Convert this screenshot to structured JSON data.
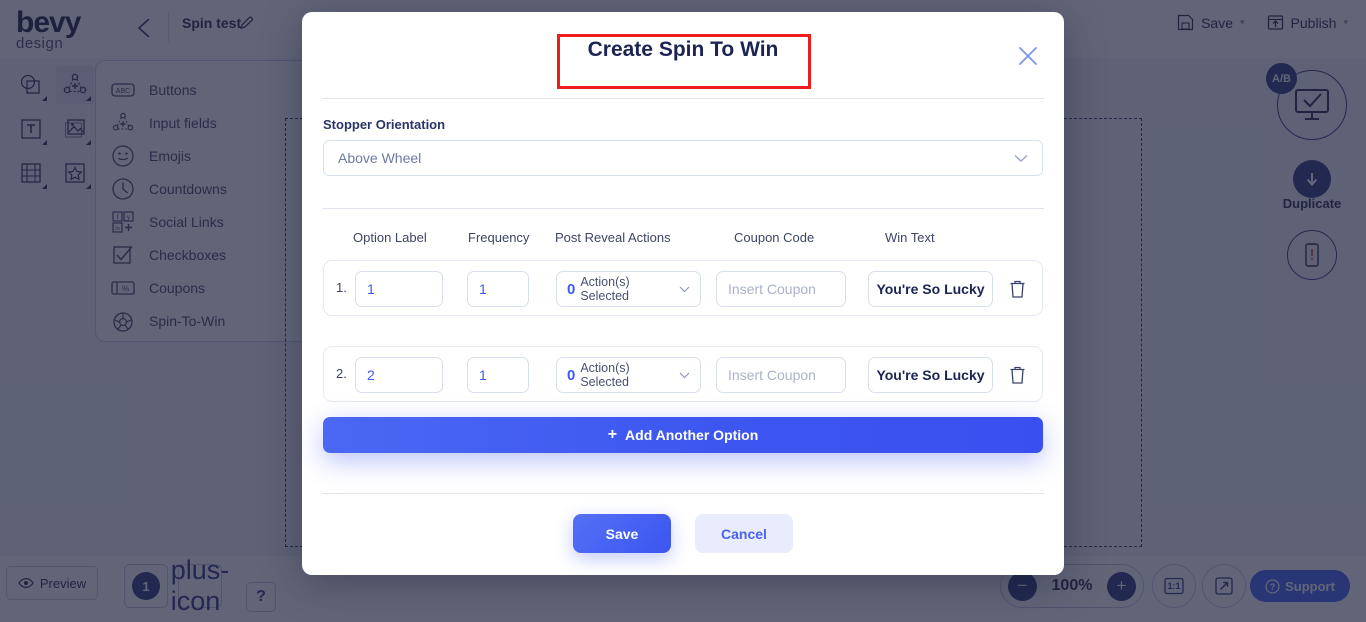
{
  "app": {
    "logo_main": "bevy",
    "logo_sub": "design",
    "project_name": "Spin test",
    "back_icon": "chevron-left-icon",
    "edit_icon": "pencil-icon"
  },
  "topbar": {
    "actions": [
      {
        "label": "Save",
        "icon": "floppy-disk-icon",
        "caret": "▾"
      },
      {
        "label": "Publish",
        "icon": "publish-upload-icon",
        "caret": "▾"
      }
    ]
  },
  "tool_palette": {
    "items": [
      {
        "name": "shapes-tool",
        "icon": "shapes-icon",
        "active": false
      },
      {
        "name": "elements-tool",
        "icon": "elements-node-icon",
        "active": true
      },
      {
        "name": "text-tool",
        "icon": "text-t-icon",
        "active": false
      },
      {
        "name": "image-tool",
        "icon": "image-icon",
        "active": false
      },
      {
        "name": "video-tool",
        "icon": "film-strip-icon",
        "active": false
      },
      {
        "name": "shape-star-tool",
        "icon": "star-icon",
        "active": false
      }
    ]
  },
  "flyout_menu": {
    "items": [
      {
        "label": "Buttons",
        "icon": "abc-button-icon"
      },
      {
        "label": "Input fields",
        "icon": "input-node-icon"
      },
      {
        "label": "Emojis",
        "icon": "smiley-icon"
      },
      {
        "label": "Countdowns",
        "icon": "clock-icon"
      },
      {
        "label": "Social Links",
        "icon": "social-grid-icon"
      },
      {
        "label": "Checkboxes",
        "icon": "checkbox-icon"
      },
      {
        "label": "Coupons",
        "icon": "coupon-percent-icon"
      },
      {
        "label": "Spin-To-Win",
        "icon": "spin-wheel-icon"
      }
    ]
  },
  "right_rail": {
    "ab_badge": "A/B",
    "ab_icon": "monitor-check-icon",
    "duplicate_label": "Duplicate",
    "duplicate_icon": "arrow-down-circle-icon",
    "mobile_icon": "mobile-alert-icon"
  },
  "bottombar": {
    "preview_label": "Preview",
    "preview_icon": "eye-icon",
    "page_number": "1",
    "add_page_icon": "plus-icon",
    "help_label": "?",
    "zoom": {
      "minus": "−",
      "value": "100%",
      "plus": "+"
    },
    "fit_label": "1:1",
    "expand_icon": "expand-arrow-icon",
    "support_label": "Support",
    "support_icon": "question-circle-icon"
  },
  "modal": {
    "title": "Create Spin To Win",
    "close_icon": "close-x-icon",
    "annotation_color": "#ee1c1c",
    "stopper": {
      "label": "Stopper Orientation",
      "value": "Above Wheel",
      "chevron_icon": "chevron-down-icon"
    },
    "table": {
      "headers": [
        "Option Label",
        "Frequency",
        "Post Reveal Actions",
        "Coupon Code",
        "Win Text"
      ],
      "rows": [
        {
          "index": "1.",
          "option_label": "1",
          "frequency": "1",
          "actions_count": "0",
          "actions_text": "Action(s) Selected",
          "coupon_value": "",
          "coupon_placeholder": "Insert Coupon",
          "win_text": "You're So Lucky",
          "delete_icon": "trash-icon"
        },
        {
          "index": "2.",
          "option_label": "2",
          "frequency": "1",
          "actions_count": "0",
          "actions_text": "Action(s) Selected",
          "coupon_value": "",
          "coupon_placeholder": "Insert Coupon",
          "win_text": "You're So Lucky",
          "delete_icon": "trash-icon"
        }
      ]
    },
    "add_option_label": "Add Another Option",
    "add_option_plus": "+",
    "save_label": "Save",
    "cancel_label": "Cancel"
  },
  "colors": {
    "accent_blue": "#3d56f0",
    "dark_navy": "#1b2452",
    "annotation_red": "#ee1c1c"
  }
}
